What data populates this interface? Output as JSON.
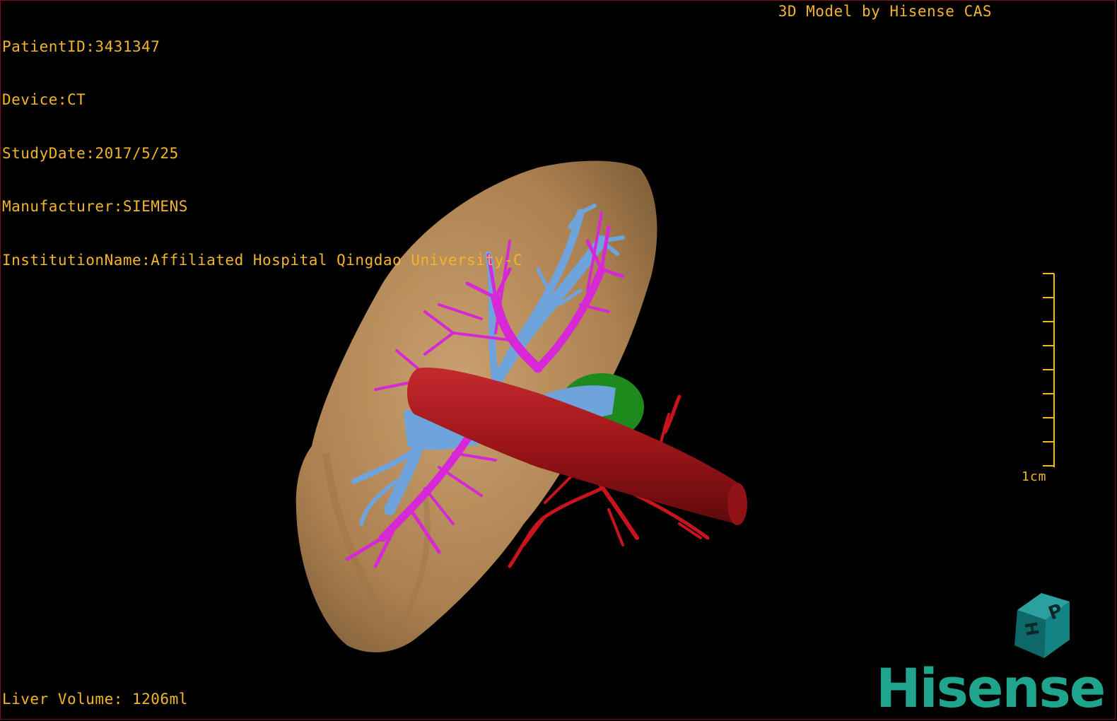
{
  "info": {
    "patient_id": "PatientID:3431347",
    "device": "Device:CT",
    "study_date": "StudyDate:2017/5/25",
    "manufacturer": "Manufacturer:SIEMENS",
    "institution": "InstitutionName:Affiliated Hospital Qingdao University-C"
  },
  "title": "3D Model by Hisense CAS",
  "liver_volume": "Liver Volume: 1206ml",
  "scale_label": "1cm",
  "brand": "Hisense",
  "orientation_cube": {
    "faces": [
      "P",
      "H"
    ]
  },
  "colors": {
    "overlay_text": "#f2b52a",
    "liver": "#c89a62",
    "portal_vein": "#d628d6",
    "hepatic_vein": "#6fa3dc",
    "vena_cava": "#a5141a",
    "artery": "#c8141c",
    "gallbladder": "#1e8a1e",
    "brand": "#1fa58e",
    "border": "#7a1212"
  }
}
